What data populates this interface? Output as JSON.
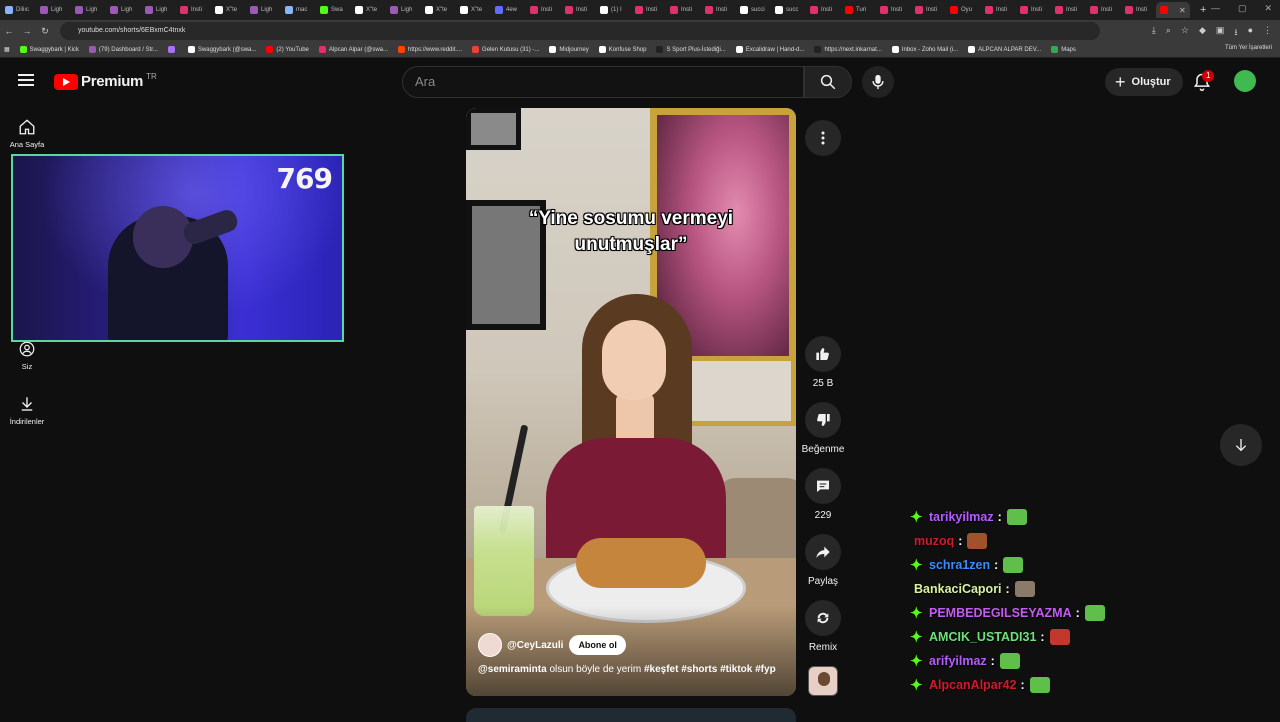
{
  "browser": {
    "tabs": [
      {
        "label": "Diliıc",
        "color": "#8ab4f8"
      },
      {
        "label": "Ligh",
        "color": "#9b59b6"
      },
      {
        "label": "Ligh",
        "color": "#9b59b6"
      },
      {
        "label": "Ligh",
        "color": "#9b59b6"
      },
      {
        "label": "Ligh",
        "color": "#9b59b6"
      },
      {
        "label": "Insti",
        "color": "#e1306c"
      },
      {
        "label": "X\"te",
        "color": "#ffffff"
      },
      {
        "label": "Ligh",
        "color": "#9b59b6"
      },
      {
        "label": "mac",
        "color": "#8ab4f8"
      },
      {
        "label": "Swa",
        "color": "#53fc18"
      },
      {
        "label": "X\"te",
        "color": "#ffffff"
      },
      {
        "label": "Ligh",
        "color": "#9b59b6"
      },
      {
        "label": "X\"te",
        "color": "#ffffff"
      },
      {
        "label": "X\"te",
        "color": "#ffffff"
      },
      {
        "label": "4ew",
        "color": "#5f6cff"
      },
      {
        "label": "Insti",
        "color": "#e1306c"
      },
      {
        "label": "Insti",
        "color": "#e1306c"
      },
      {
        "label": "(1) I",
        "color": "#ffffff"
      },
      {
        "label": "Insti",
        "color": "#e1306c"
      },
      {
        "label": "Insti",
        "color": "#e1306c"
      },
      {
        "label": "Insti",
        "color": "#e1306c"
      },
      {
        "label": "succi",
        "color": "#ffffff"
      },
      {
        "label": "succ",
        "color": "#ffffff"
      },
      {
        "label": "Insti",
        "color": "#e1306c"
      },
      {
        "label": "Turi",
        "color": "#ff0000"
      },
      {
        "label": "Insti",
        "color": "#e1306c"
      },
      {
        "label": "Insti",
        "color": "#e1306c"
      },
      {
        "label": "Oyu",
        "color": "#ff0000"
      },
      {
        "label": "Insti",
        "color": "#e1306c"
      },
      {
        "label": "Insti",
        "color": "#e1306c"
      },
      {
        "label": "Insti",
        "color": "#e1306c"
      },
      {
        "label": "Insti",
        "color": "#e1306c"
      },
      {
        "label": "Insti",
        "color": "#e1306c"
      }
    ],
    "url": "youtube.com/shorts/6EBxmC4tnxk",
    "bookmarks": [
      {
        "label": "Swaggybark | Kick",
        "color": "#53fc18"
      },
      {
        "label": "(79) Dashboard / Str...",
        "color": "#9b59b6"
      },
      {
        "label": "",
        "color": "#a970ff"
      },
      {
        "label": "Swaggybark (@swa...",
        "color": "#ffffff"
      },
      {
        "label": "(2) YouTube",
        "color": "#ff0000"
      },
      {
        "label": "Alpcan Alpar (@swa...",
        "color": "#e1306c"
      },
      {
        "label": "https://www.reddit....",
        "color": "#ff4500"
      },
      {
        "label": "Gelen Kutusu (31) -...",
        "color": "#ea4335"
      },
      {
        "label": "Midjourney",
        "color": "#ffffff"
      },
      {
        "label": "Konfuse Shop",
        "color": "#ffffff"
      },
      {
        "label": "S Sport Plus-İstediği...",
        "color": "#222222"
      },
      {
        "label": "Excalidraw | Hand-d...",
        "color": "#ffffff"
      },
      {
        "label": "https://next.inkarnat...",
        "color": "#222222"
      },
      {
        "label": "Inbox - Zoho Mail (i...",
        "color": "#ffffff"
      },
      {
        "label": "ALPCAN ALPAR DEV...",
        "color": "#ffffff"
      },
      {
        "label": "Maps",
        "color": "#34a853"
      }
    ],
    "all_bookmarks": "Tüm Yer İşaretleri"
  },
  "header": {
    "logo_text": "Premium",
    "country": "TR",
    "search_placeholder": "Ara",
    "create_label": "Oluştur",
    "notifications_count": "1"
  },
  "sidebar": {
    "home": "Ana Sayfa",
    "you": "Siz",
    "downloads": "İndirilenler"
  },
  "webcam": {
    "counter": "769"
  },
  "short": {
    "caption_line1": "“Yine sosumu vermeyi",
    "caption_line2": "unutmuşlar”",
    "channel": "@CeyLazuli",
    "subscribe": "Abone ol",
    "desc_mention": "@semiraminta",
    "desc_text": " olsun böyle de yerim ",
    "desc_tags": "#keşfet #shorts #tiktok #fyp"
  },
  "actions": {
    "likes": "25 B",
    "dislike": "Beğenme",
    "comments": "229",
    "share": "Paylaş",
    "remix": "Remix"
  },
  "chat": [
    {
      "user": "tarikyilmaz",
      "color": "#b65cff",
      "badge": true,
      "emote_color": "#5fbf4a"
    },
    {
      "user": "muzoq",
      "color": "#d11a2a",
      "badge": false,
      "emote_color": "#a0522d"
    },
    {
      "user": "schra1zen",
      "color": "#3d8bff",
      "badge": true,
      "emote_color": "#5fbf4a"
    },
    {
      "user": "BankaciCapori",
      "color": "#d8f3a0",
      "badge": false,
      "emote_color": "#8a7a6a"
    },
    {
      "user": "PEMBEDEGILSEYAZMA",
      "color": "#c45cf2",
      "badge": true,
      "emote_color": "#5fbf4a"
    },
    {
      "user": "AMCIK_USTADI31",
      "color": "#6ee07a",
      "badge": true,
      "emote_color": "#c0392b"
    },
    {
      "user": "arifyilmaz",
      "color": "#b65cff",
      "badge": true,
      "emote_color": "#5fbf4a"
    },
    {
      "user": "AlpcanAlpar42",
      "color": "#d11a2a",
      "badge": true,
      "emote_color": "#5fbf4a"
    }
  ]
}
